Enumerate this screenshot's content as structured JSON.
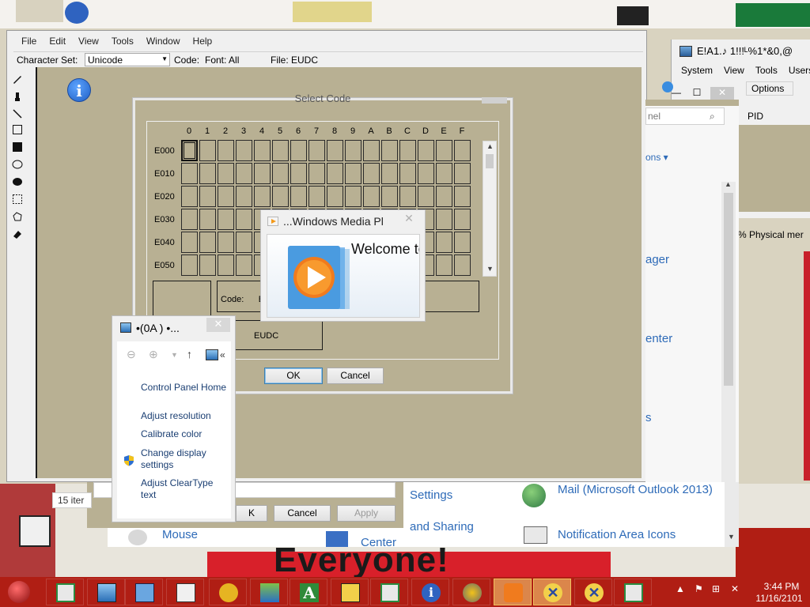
{
  "eudc": {
    "menu": [
      "File",
      "Edit",
      "View",
      "Tools",
      "Window",
      "Help"
    ],
    "charset_label": "Character Set:",
    "charset_value": "Unicode",
    "code_label": "Code:",
    "font_label": "Font: All",
    "file_label": "File: EUDC"
  },
  "select_code": {
    "title": "Select Code",
    "columns": [
      "0",
      "1",
      "2",
      "3",
      "4",
      "5",
      "6",
      "7",
      "8",
      "9",
      "A",
      "B",
      "C",
      "D",
      "E",
      "F"
    ],
    "rows": [
      "E000",
      "E010",
      "E020",
      "E030",
      "E040",
      "E050"
    ],
    "code_label": "Code:",
    "code_value": "E",
    "eudc_label": "EUDC",
    "ok_label": "OK",
    "cancel_label": "Cancel"
  },
  "wmp": {
    "title": "...Windows Media Pl",
    "welcome": "Welcome to",
    "close": "✕"
  },
  "display": {
    "title": "•(0A    )     •...",
    "close": "✕",
    "breadcrumb_chevron": "«",
    "links": [
      "Control Panel Home",
      "Adjust resolution",
      "Calibrate color",
      "Change display settings",
      "Adjust ClearType text"
    ]
  },
  "task_manager": {
    "title": "E!A1.♪   1!!!ᴸ%1*&0,@",
    "menu": [
      "System",
      "View",
      "Tools",
      "Users"
    ],
    "options_label": "Options",
    "pid_label": "PID",
    "physical_label": "%  Physical mer"
  },
  "cp_right": {
    "search_placeholder": "nel",
    "ons": "ons ▾",
    "links": [
      "ager",
      "enter",
      "s"
    ]
  },
  "cp_bottom": {
    "settings": "Settings",
    "sharing": "and Sharing",
    "mail": "Mail (Microsoft Outlook 2013)",
    "notification": "Notification Area Icons",
    "mouse": "Mouse",
    "center": "Center"
  },
  "lower_dialog": {
    "items": "15 iter",
    "ok_fragment": "K",
    "cancel_label": "Cancel",
    "apply_label": "Apply"
  },
  "wallpaper": {
    "billboard_text": "Everyone!"
  },
  "taskbar": {
    "time": "3:44 PM",
    "date": "11/16/2101"
  },
  "colors": {
    "eudc_bg": "#b8b093",
    "taskbar": "#b01e14",
    "link_blue": "#2e6bb8"
  }
}
